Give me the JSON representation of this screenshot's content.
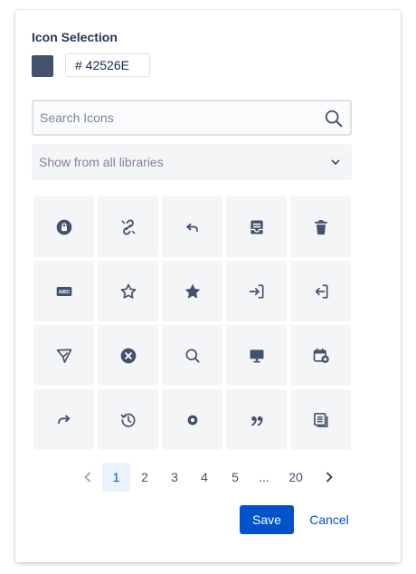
{
  "header": {
    "title": "Icon Selection"
  },
  "color_picker": {
    "swatch_color": "#42526E",
    "hex_value": "# 42526E"
  },
  "search": {
    "placeholder": "Search Icons",
    "value": ""
  },
  "library_select": {
    "selected": "Show from all libraries"
  },
  "icons": [
    "lock-circle-icon",
    "unlink-icon",
    "undo-icon",
    "inbox-icon",
    "trash-icon",
    "abc-icon",
    "star-outline-icon",
    "star-filled-icon",
    "sign-in-icon",
    "sign-out-icon",
    "send-icon",
    "cross-circle-icon",
    "search-icon",
    "monitor-icon",
    "calendar-add-icon",
    "redo-icon",
    "history-icon",
    "radio-dot-icon",
    "quote-icon",
    "document-icon"
  ],
  "pagination": {
    "pages": [
      "1",
      "2",
      "3",
      "4",
      "5",
      "...",
      "20"
    ],
    "current": "1"
  },
  "actions": {
    "save_label": "Save",
    "cancel_label": "Cancel"
  },
  "colors": {
    "icon": "#42526E",
    "primary": "#0052CC",
    "tile": "#F4F5F7"
  }
}
